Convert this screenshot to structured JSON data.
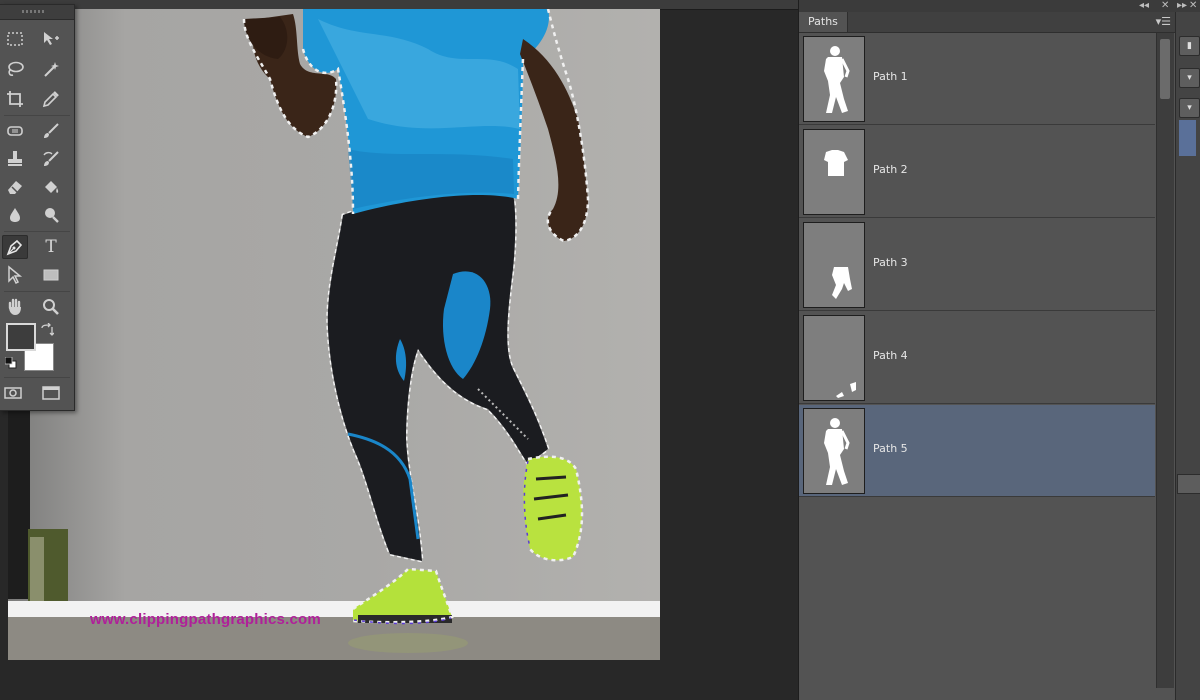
{
  "canvas": {
    "watermark": "www.clippingpathgraphics.com"
  },
  "tools": [
    {
      "name": "rectangular-marquee-tool",
      "icon": "marquee-icon"
    },
    {
      "name": "move-tool",
      "icon": "move-icon"
    },
    {
      "name": "lasso-tool",
      "icon": "lasso-icon"
    },
    {
      "name": "magic-wand-tool",
      "icon": "magic-wand-icon"
    },
    {
      "name": "crop-tool",
      "icon": "crop-icon"
    },
    {
      "name": "eyedropper-tool",
      "icon": "eyedropper-icon"
    },
    {
      "name": "spot-healing-tool",
      "icon": "healing-icon"
    },
    {
      "name": "brush-tool",
      "icon": "brush-icon"
    },
    {
      "name": "clone-stamp-tool",
      "icon": "stamp-icon"
    },
    {
      "name": "history-brush-tool",
      "icon": "history-brush-icon"
    },
    {
      "name": "eraser-tool",
      "icon": "eraser-icon"
    },
    {
      "name": "paint-bucket-tool",
      "icon": "paint-bucket-icon"
    },
    {
      "name": "blur-tool",
      "icon": "blur-icon"
    },
    {
      "name": "dodge-tool",
      "icon": "dodge-icon"
    },
    {
      "name": "pen-tool",
      "icon": "pen-icon",
      "active": true
    },
    {
      "name": "type-tool",
      "icon": "type-icon",
      "label": "T"
    },
    {
      "name": "path-selection-tool",
      "icon": "path-selection-icon"
    },
    {
      "name": "rectangle-tool",
      "icon": "rectangle-icon"
    },
    {
      "name": "hand-tool",
      "icon": "hand-icon"
    },
    {
      "name": "zoom-tool",
      "icon": "zoom-icon"
    }
  ],
  "colors": {
    "foreground": "#3d3d3d",
    "background": "#ffffff",
    "selected_row": "#59667b",
    "watermark": "#b0209a"
  },
  "paths_panel": {
    "tab_label": "Paths",
    "menu_icon": "panel-menu-icon",
    "rows": [
      {
        "name": "Path 1",
        "selected": false
      },
      {
        "name": "Path 2",
        "selected": false
      },
      {
        "name": "Path 3",
        "selected": false
      },
      {
        "name": "Path 4",
        "selected": false
      },
      {
        "name": "Path 5",
        "selected": true
      }
    ]
  },
  "dock": {
    "collapse_label": "◂◂",
    "close_label": "✕",
    "expand_label": "▸▸"
  }
}
